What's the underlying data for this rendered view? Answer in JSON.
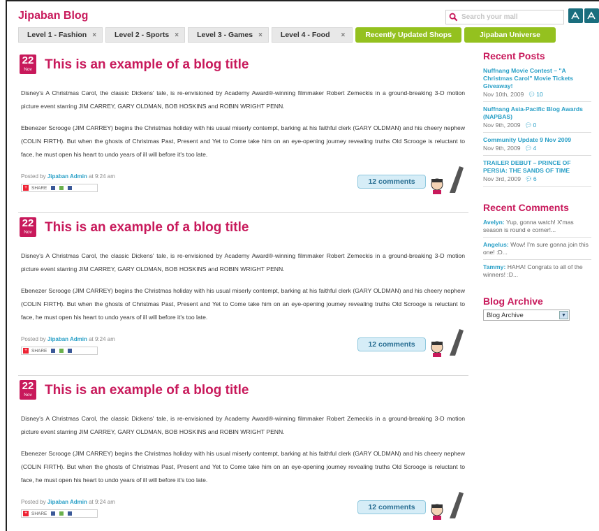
{
  "header": {
    "logo": "Jipaban Blog",
    "search_placeholder": "Search your mall"
  },
  "nav": {
    "tabs": [
      {
        "label": "Level 1 - Fashion"
      },
      {
        "label": "Level 2 - Sports"
      },
      {
        "label": "Level 3 - Games"
      },
      {
        "label": "Level 4 - Food"
      }
    ],
    "close_glyph": "×",
    "green_tabs": [
      {
        "label": "Recently Updated Shops"
      },
      {
        "label": "Jipaban Universe"
      }
    ]
  },
  "posts": [
    {
      "day": "22",
      "month": "Nov",
      "title": "This is an example of a blog title",
      "paragraphs": [
        "Disney's A Christmas Carol, the classic Dickens' tale, is re-envisioned by Academy Award®-winning filmmaker Robert Zemeckis in a ground-breaking 3-D motion picture event starring JIM CARREY, GARY OLDMAN, BOB HOSKINS and ROBIN WRIGHT PENN.",
        "Ebenezer Scrooge (JIM CARREY) begins the Christmas holiday with his usual miserly contempt, barking at his faithful clerk (GARY OLDMAN) and his cheery nephew (COLIN FIRTH). But when the ghosts of Christmas Past, Present and Yet to Come take him on an eye-opening journey revealing truths Old Scrooge is reluctant to face, he must open his heart to undo years of ill will before it's too late."
      ],
      "posted_by": "Posted by",
      "author": "Jipaban Admin",
      "time": "at 9:24 am",
      "share": "SHARE",
      "comments": "12 comments"
    },
    {
      "day": "22",
      "month": "Nov",
      "title": "This is an example of a blog title",
      "paragraphs": [
        "Disney's A Christmas Carol, the classic Dickens' tale, is re-envisioned by Academy Award®-winning filmmaker Robert Zemeckis in a ground-breaking 3-D motion picture event starring JIM CARREY, GARY OLDMAN, BOB HOSKINS and ROBIN WRIGHT PENN.",
        "Ebenezer Scrooge (JIM CARREY) begins the Christmas holiday with his usual miserly contempt, barking at his faithful clerk (GARY OLDMAN) and his cheery nephew (COLIN FIRTH). But when the ghosts of Christmas Past, Present and Yet to Come take him on an eye-opening journey revealing truths Old Scrooge is reluctant to face, he must open his heart to undo years of ill will before it's too late."
      ],
      "posted_by": "Posted by",
      "author": "Jipaban Admin",
      "time": "at 9:24 am",
      "share": "SHARE",
      "comments": "12 comments"
    },
    {
      "day": "22",
      "month": "Nov",
      "title": "This is an example of a blog title",
      "paragraphs": [
        "Disney's A Christmas Carol, the classic Dickens' tale, is re-envisioned by Academy Award®-winning filmmaker Robert Zemeckis in a ground-breaking 3-D motion picture event starring JIM CARREY, GARY OLDMAN, BOB HOSKINS and ROBIN WRIGHT PENN.",
        "Ebenezer Scrooge (JIM CARREY) begins the Christmas holiday with his usual miserly contempt, barking at his faithful clerk (GARY OLDMAN) and his cheery nephew (COLIN FIRTH). But when the ghosts of Christmas Past, Present and Yet to Come take him on an eye-opening journey revealing truths Old Scrooge is reluctant to face, he must open his heart to undo years of ill will before it's too late."
      ],
      "posted_by": "Posted by",
      "author": "Jipaban Admin",
      "time": "at 9:24 am",
      "share": "SHARE",
      "comments": "12 comments"
    }
  ],
  "sidebar": {
    "recent_posts_heading": "Recent Posts",
    "recent_posts": [
      {
        "title": "Nuffnang Movie Contest – \"A Christmas Carol\" Movie Tickets Giveaway!",
        "date": "Nov 10th, 2009",
        "comments": "10"
      },
      {
        "title": "Nuffnang Asia-Pacific Blog Awards (NAPBAS)",
        "date": "Nov 9th, 2009",
        "comments": "0"
      },
      {
        "title": "Community Update 9 Nov 2009",
        "date": "Nov 9th, 2009",
        "comments": "4"
      },
      {
        "title": "TRAILER DEBUT – PRINCE OF PERSIA: THE SANDS OF TIME",
        "date": "Nov 3rd, 2009",
        "comments": "6"
      }
    ],
    "recent_comments_heading": "Recent Comments",
    "recent_comments": [
      {
        "author": "Avelyn:",
        "text": "Yup, gonna watch! X'mas season is round e corner!..."
      },
      {
        "author": "Angelus:",
        "text": "Wow! I'm sure gonna join this one! :D..."
      },
      {
        "author": "Tammy:",
        "text": "HAHA! Congrats to all of the winners! :D..."
      }
    ],
    "archive_heading": "Blog Archive",
    "archive_select": "Blog Archive"
  },
  "colors": {
    "brand": "#c8195b",
    "link": "#2aa0c7",
    "green": "#94c11f"
  }
}
